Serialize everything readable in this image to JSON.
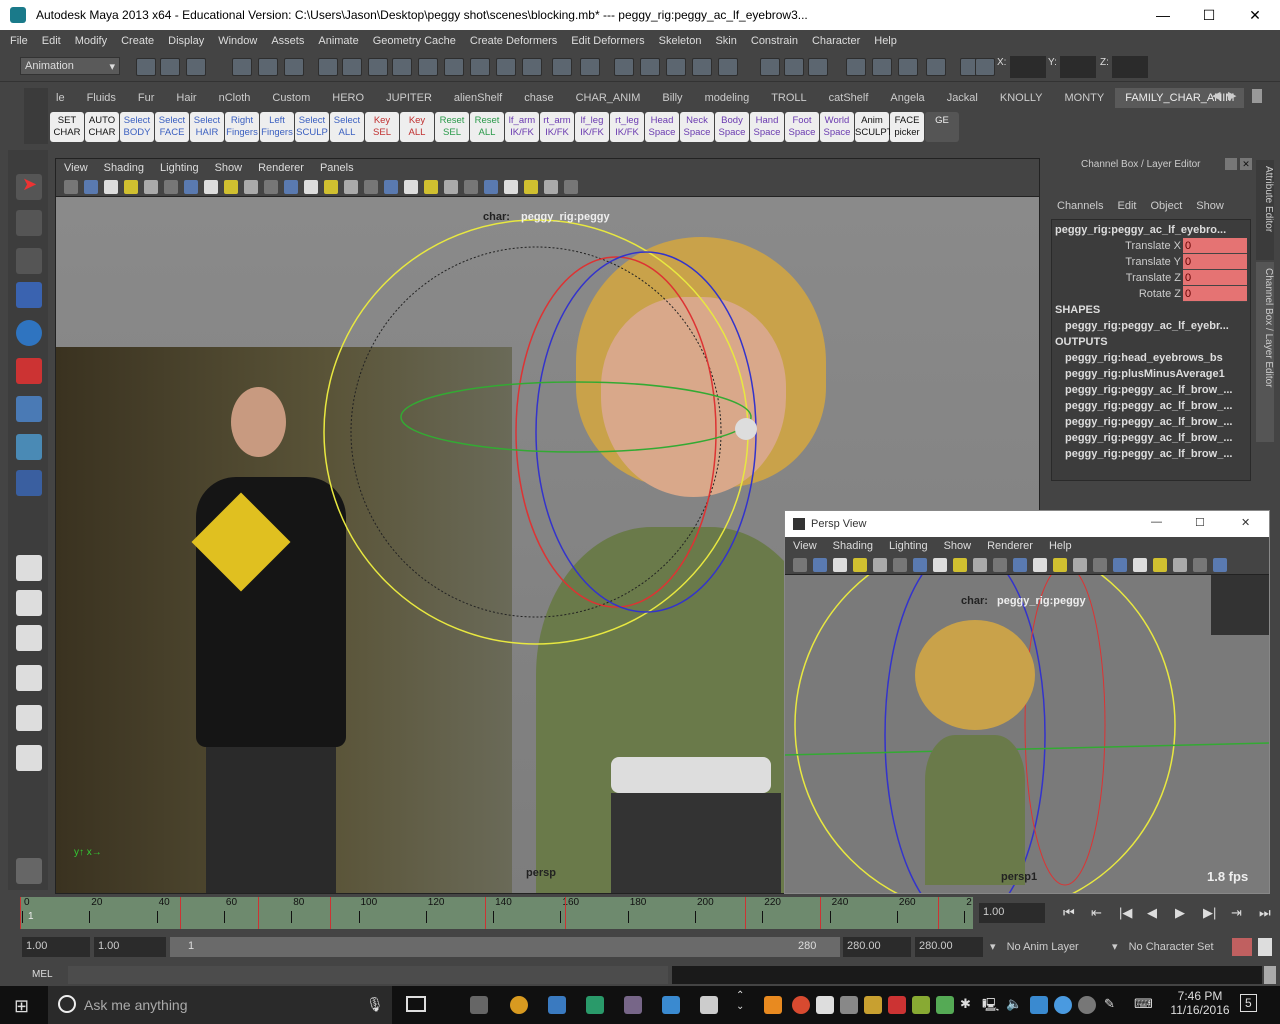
{
  "window": {
    "title": "Autodesk Maya 2013 x64 - Educational Version: C:\\Users\\Jason\\Desktop\\peggy shot\\scenes\\blocking.mb*   ---   peggy_rig:peggy_ac_lf_eyebrow3...",
    "minimize": "—",
    "maximize": "☐",
    "close": "✕"
  },
  "menubar": [
    "File",
    "Edit",
    "Modify",
    "Create",
    "Display",
    "Window",
    "Assets",
    "Animate",
    "Geometry Cache",
    "Create Deformers",
    "Edit Deformers",
    "Skeleton",
    "Skin",
    "Constrain",
    "Character",
    "Help"
  ],
  "statusline": {
    "mode": "Animation",
    "x_label": "X:",
    "y_label": "Y:",
    "z_label": "Z:"
  },
  "shelf_tabs": [
    "le",
    "Fluids",
    "Fur",
    "Hair",
    "nCloth",
    "Custom",
    "HERO",
    "JUPITER",
    "alienShelf",
    "chase",
    "CHAR_ANIM",
    "Billy",
    "modeling",
    "TROLL",
    "catShelf",
    "Angela",
    "Jackal",
    "KNOLLY",
    "MONTY",
    "FAMILY_CHAR_ANIM"
  ],
  "shelf_active": "FAMILY_CHAR_ANIM",
  "shelf_buttons": [
    {
      "l1": "SET",
      "l2": "CHAR",
      "color": "#111"
    },
    {
      "l1": "AUTO",
      "l2": "CHAR",
      "color": "#111"
    },
    {
      "l1": "Select",
      "l2": "BODY",
      "color": "#3a5fc0"
    },
    {
      "l1": "Select",
      "l2": "FACE",
      "color": "#3a5fc0"
    },
    {
      "l1": "Select",
      "l2": "HAIR",
      "color": "#3a5fc0"
    },
    {
      "l1": "Right",
      "l2": "Fingers",
      "color": "#3a5fc0"
    },
    {
      "l1": "Left",
      "l2": "Fingers",
      "color": "#3a5fc0"
    },
    {
      "l1": "Select",
      "l2": "SCULP",
      "color": "#3a5fc0"
    },
    {
      "l1": "Select",
      "l2": "ALL",
      "color": "#3a5fc0"
    },
    {
      "l1": "Key",
      "l2": "SEL",
      "color": "#c03030"
    },
    {
      "l1": "Key",
      "l2": "ALL",
      "color": "#c03030"
    },
    {
      "l1": "Reset",
      "l2": "SEL",
      "color": "#2a9a4a"
    },
    {
      "l1": "Reset",
      "l2": "ALL",
      "color": "#2a9a4a"
    },
    {
      "l1": "lf_arm",
      "l2": "IK/FK",
      "color": "#6a3ab0"
    },
    {
      "l1": "rt_arm",
      "l2": "IK/FK",
      "color": "#6a3ab0"
    },
    {
      "l1": "lf_leg",
      "l2": "IK/FK",
      "color": "#6a3ab0"
    },
    {
      "l1": "rt_leg",
      "l2": "IK/FK",
      "color": "#6a3ab0"
    },
    {
      "l1": "Head",
      "l2": "Space",
      "color": "#6a3ab0"
    },
    {
      "l1": "Neck",
      "l2": "Space",
      "color": "#6a3ab0"
    },
    {
      "l1": "Body",
      "l2": "Space",
      "color": "#6a3ab0"
    },
    {
      "l1": "Hand",
      "l2": "Space",
      "color": "#6a3ab0"
    },
    {
      "l1": "Foot",
      "l2": "Space",
      "color": "#6a3ab0"
    },
    {
      "l1": "World",
      "l2": "Space",
      "color": "#6a3ab0"
    },
    {
      "l1": "Anim",
      "l2": "SCULPT",
      "color": "#111"
    },
    {
      "l1": "FACE",
      "l2": "picker",
      "color": "#111"
    },
    {
      "l1": "",
      "l2": "GE",
      "color": "#eee"
    }
  ],
  "viewport": {
    "menu": [
      "View",
      "Shading",
      "Lighting",
      "Show",
      "Renderer",
      "Panels"
    ],
    "hud_label": "char:",
    "hud_value": "peggy_rig:peggy",
    "camera": "persp"
  },
  "channel_box": {
    "title": "Channel Box / Layer Editor",
    "menu": [
      "Channels",
      "Edit",
      "Object",
      "Show"
    ],
    "node": "peggy_rig:peggy_ac_lf_eyebro...",
    "attributes": [
      {
        "name": "Translate X",
        "value": "0"
      },
      {
        "name": "Translate Y",
        "value": "0"
      },
      {
        "name": "Translate Z",
        "value": "0"
      },
      {
        "name": "Rotate Z",
        "value": "0"
      }
    ],
    "shapes_header": "SHAPES",
    "shapes": [
      "peggy_rig:peggy_ac_lf_eyebr..."
    ],
    "outputs_header": "OUTPUTS",
    "outputs": [
      "peggy_rig:head_eyebrows_bs",
      "peggy_rig:plusMinusAverage1",
      "peggy_rig:peggy_ac_lf_brow_...",
      "peggy_rig:peggy_ac_lf_brow_...",
      "peggy_rig:peggy_ac_lf_brow_...",
      "peggy_rig:peggy_ac_lf_brow_...",
      "peggy_rig:peggy_ac_lf_brow_..."
    ],
    "side_tabs": [
      "Attribute Editor",
      "Channel Box / Layer Editor"
    ]
  },
  "persp_window": {
    "title": "Persp View",
    "menu": [
      "View",
      "Shading",
      "Lighting",
      "Show",
      "Renderer",
      "Help"
    ],
    "hud_label": "char:",
    "hud_value": "peggy_rig:peggy",
    "camera": "persp1",
    "fps": "1.8 fps"
  },
  "timeline": {
    "ticks": [
      "0",
      "20",
      "40",
      "60",
      "80",
      "100",
      "120",
      "140",
      "160",
      "180",
      "200",
      "220",
      "240",
      "260",
      "2"
    ],
    "current_frame_marker": "1",
    "current_time": "1.00"
  },
  "range": {
    "start": "1.00",
    "playback_start": "1.00",
    "slider_start": "1",
    "slider_end": "280",
    "playback_end": "280.00",
    "end": "280.00",
    "anim_layer": "No Anim Layer",
    "character_set": "No Character Set"
  },
  "command_line": {
    "label": "MEL"
  },
  "taskbar": {
    "search_placeholder": "Ask me anything",
    "time": "7:46 PM",
    "date": "11/16/2016",
    "notifications": "5"
  },
  "colors": {
    "accent_red_channel": "#e57373",
    "maya_gray": "#444444",
    "viewport_gray": "#7d7d7d"
  }
}
